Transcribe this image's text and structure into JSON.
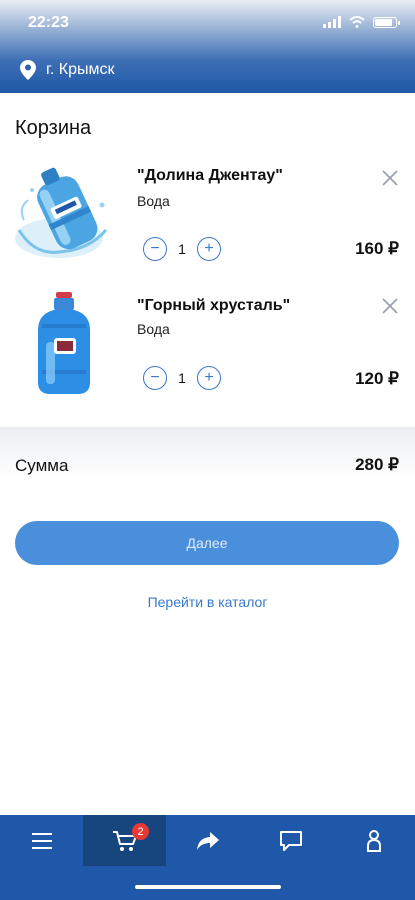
{
  "status": {
    "time": "22:23"
  },
  "header": {
    "location": "г. Крымск"
  },
  "page": {
    "title": "Корзина"
  },
  "items": [
    {
      "name": "\"Долина Джентау\"",
      "category": "Вода",
      "quantity": "1",
      "price": "160 ₽"
    },
    {
      "name": "\"Горный хрусталь\"",
      "category": "Вода",
      "quantity": "1",
      "price": "120 ₽"
    }
  ],
  "summary": {
    "label": "Сумма",
    "value": "280 ₽"
  },
  "actions": {
    "next_label": "Далее",
    "catalog_link": "Перейти в каталог"
  },
  "tabbar": {
    "tabs": [
      {
        "icon": "menu-icon"
      },
      {
        "icon": "cart-icon",
        "badge": "2",
        "active": true
      },
      {
        "icon": "share-icon"
      },
      {
        "icon": "chat-icon"
      },
      {
        "icon": "profile-icon"
      }
    ]
  },
  "colors": {
    "brand": "#1f58a8",
    "accent": "#4a8fdc",
    "badge": "#e53935"
  }
}
